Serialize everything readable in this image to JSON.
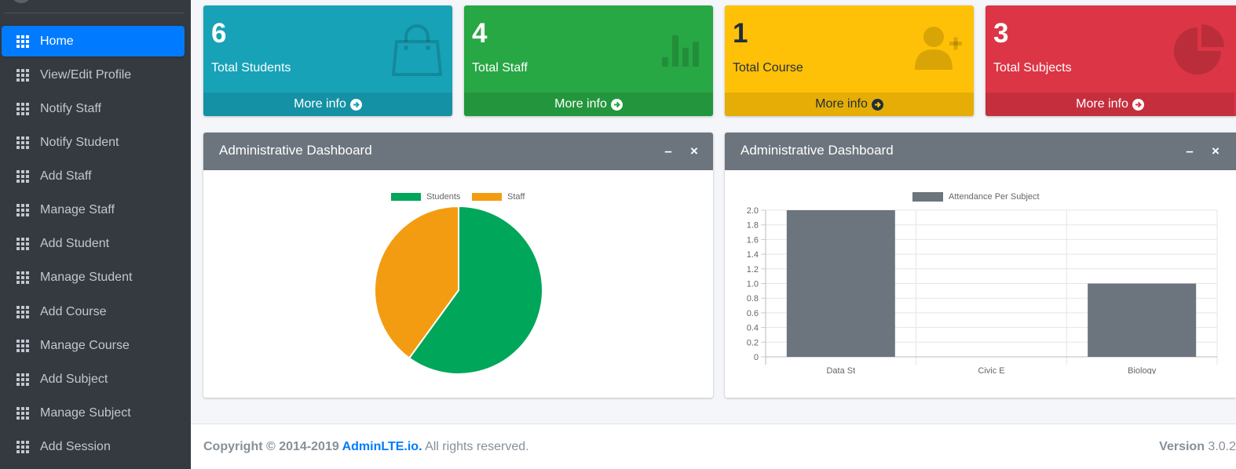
{
  "sidebar": {
    "items": [
      {
        "label": "Home",
        "active": true
      },
      {
        "label": "View/Edit Profile"
      },
      {
        "label": "Notify Staff"
      },
      {
        "label": "Notify Student"
      },
      {
        "label": "Add Staff"
      },
      {
        "label": "Manage Staff"
      },
      {
        "label": "Add Student"
      },
      {
        "label": "Manage Student"
      },
      {
        "label": "Add Course"
      },
      {
        "label": "Manage Course"
      },
      {
        "label": "Add Subject"
      },
      {
        "label": "Manage Subject"
      },
      {
        "label": "Add Session"
      }
    ]
  },
  "stats": [
    {
      "value": "6",
      "label": "Total Students",
      "link": "More info",
      "color": "#17a2b8",
      "icon": "shopping-bag-icon"
    },
    {
      "value": "4",
      "label": "Total Staff",
      "link": "More info",
      "color": "#28a745",
      "icon": "bar-chart-icon"
    },
    {
      "value": "1",
      "label": "Total Course",
      "link": "More info",
      "color": "#ffc107",
      "icon": "user-plus-icon"
    },
    {
      "value": "3",
      "label": "Total Subjects",
      "link": "More info",
      "color": "#dc3545",
      "icon": "pie-chart-icon"
    }
  ],
  "cards": [
    {
      "title": "Administrative Dashboard",
      "minimize": "–",
      "close": "×"
    },
    {
      "title": "Administrative Dashboard",
      "minimize": "–",
      "close": "×"
    }
  ],
  "chart_data": [
    {
      "type": "pie",
      "categories": [
        "Students",
        "Staff"
      ],
      "values": [
        6,
        4
      ],
      "colors": [
        "#00a65a",
        "#f39c12"
      ],
      "legend": "top"
    },
    {
      "type": "bar",
      "categories": [
        "Data St",
        "Civic E",
        "Biology"
      ],
      "series": [
        {
          "name": "Attendance Per Subject",
          "values": [
            2,
            0,
            1
          ],
          "color": "#6c757d"
        }
      ],
      "ylim": [
        0,
        2
      ],
      "yticks": [
        "2.0",
        "1.8",
        "1.6",
        "1.4",
        "1.2",
        "1.0",
        "0.8",
        "0.6",
        "0.4",
        "0.2",
        "0"
      ],
      "grid": true,
      "legend": "top"
    }
  ],
  "footer": {
    "copyright_prefix": "Copyright © 2014-2019 ",
    "brand": "AdminLTE.io.",
    "rights": " All rights reserved.",
    "version_label": "Version",
    "version": " 3.0.2"
  }
}
